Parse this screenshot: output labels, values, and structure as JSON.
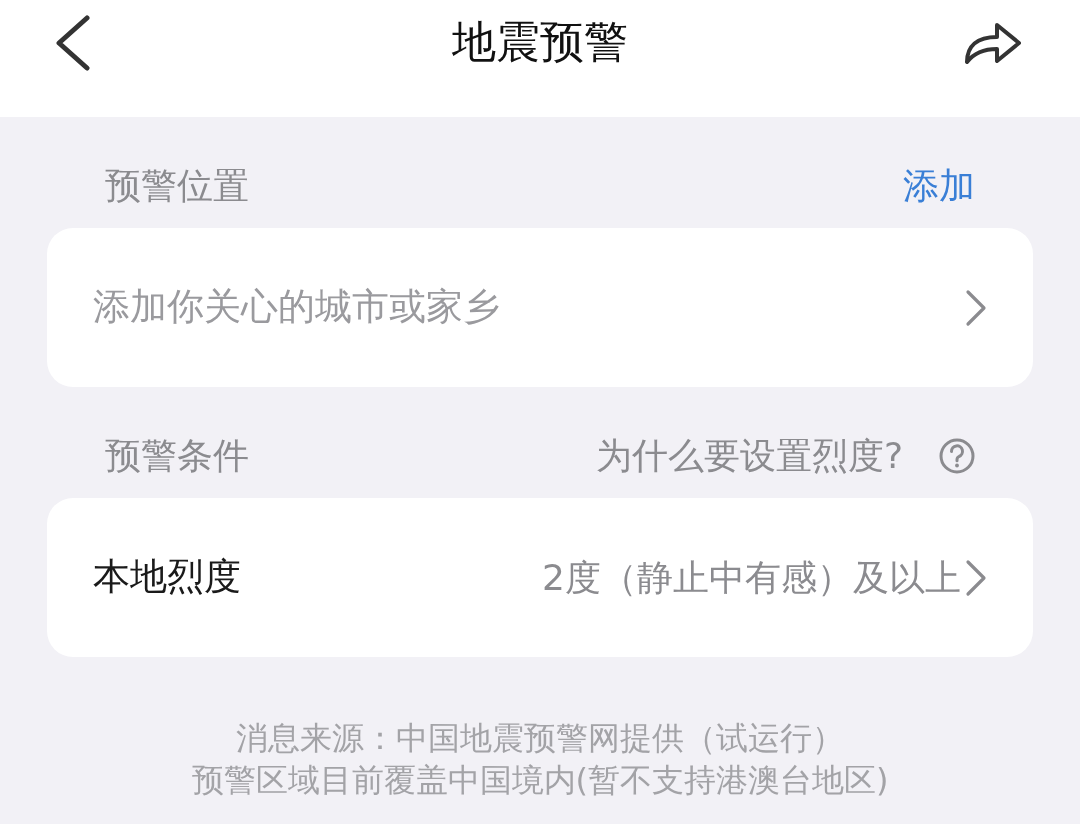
{
  "header": {
    "title": "地震预警"
  },
  "sections": [
    {
      "heading": "预警位置",
      "link": {
        "kind": "action",
        "label": "添加"
      },
      "row": {
        "placeholder": "添加你关心的城市或家乡"
      }
    },
    {
      "heading": "预警条件",
      "link": {
        "kind": "help",
        "label": "为什么要设置烈度?"
      },
      "row": {
        "label": "本地烈度",
        "value": "2度（静止中有感）及以上"
      }
    }
  ],
  "footer": [
    "消息来源：中国地震预警网提供（试运行）",
    "预警区域目前覆盖中国境内(暂不支持港澳台地区)"
  ]
}
